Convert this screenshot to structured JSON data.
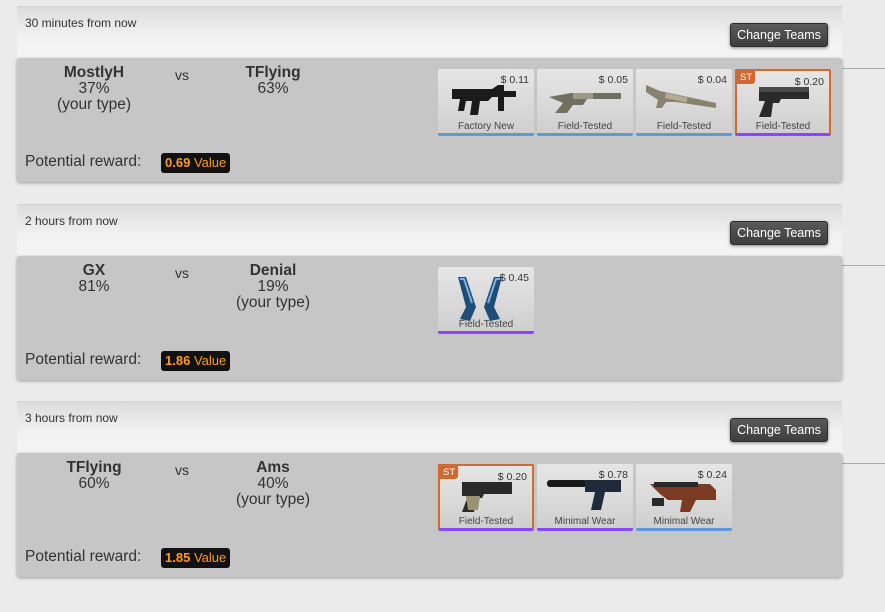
{
  "matches": [
    {
      "time": "30 minutes from now",
      "change_label": "Change Teams",
      "team_a": {
        "name": "MostlyH",
        "pct": "37%",
        "type": "(your type)"
      },
      "vs": "vs",
      "team_b": {
        "name": "TFlying",
        "pct": "63%",
        "type": ""
      },
      "reward_label": "Potential reward:",
      "reward_value": "0.69",
      "reward_unit": "Value",
      "items": [
        {
          "price": "$ 0.11",
          "wear": "Factory New",
          "icon": "smg-icon",
          "st": ""
        },
        {
          "price": "$ 0.05",
          "wear": "Field-Tested",
          "icon": "shotgun-icon",
          "st": ""
        },
        {
          "price": "$ 0.04",
          "wear": "Field-Tested",
          "icon": "shotgun-icon",
          "st": ""
        },
        {
          "price": "$ 0.20",
          "wear": "Field-Tested",
          "icon": "pistol-icon",
          "st": "ST"
        }
      ]
    },
    {
      "time": "2 hours from now",
      "change_label": "Change Teams",
      "team_a": {
        "name": "GX",
        "pct": "81%",
        "type": ""
      },
      "vs": "vs",
      "team_b": {
        "name": "Denial",
        "pct": "19%",
        "type": "(your type)"
      },
      "reward_label": "Potential reward:",
      "reward_value": "1.86",
      "reward_unit": "Value",
      "items": [
        {
          "price": "$ 0.45",
          "wear": "Field-Tested",
          "icon": "dual-pistols-icon",
          "st": ""
        }
      ]
    },
    {
      "time": "3 hours from now",
      "change_label": "Change Teams",
      "team_a": {
        "name": "TFlying",
        "pct": "60%",
        "type": ""
      },
      "vs": "vs",
      "team_b": {
        "name": "Ams",
        "pct": "40%",
        "type": "(your type)"
      },
      "reward_label": "Potential reward:",
      "reward_value": "1.85",
      "reward_unit": "Value",
      "items": [
        {
          "price": "$ 0.20",
          "wear": "Field-Tested",
          "icon": "pistol-icon",
          "st": "ST"
        },
        {
          "price": "$ 0.78",
          "wear": "Minimal Wear",
          "icon": "silenced-pistol-icon",
          "st": ""
        },
        {
          "price": "$ 0.24",
          "wear": "Minimal Wear",
          "icon": "p90-icon",
          "st": ""
        }
      ]
    }
  ],
  "colors": {
    "accent_orange": "#ff9d1a",
    "stattrak": "#cf6a32",
    "rarity_blue": "#5e98d9",
    "rarity_purple": "#8847ff"
  }
}
